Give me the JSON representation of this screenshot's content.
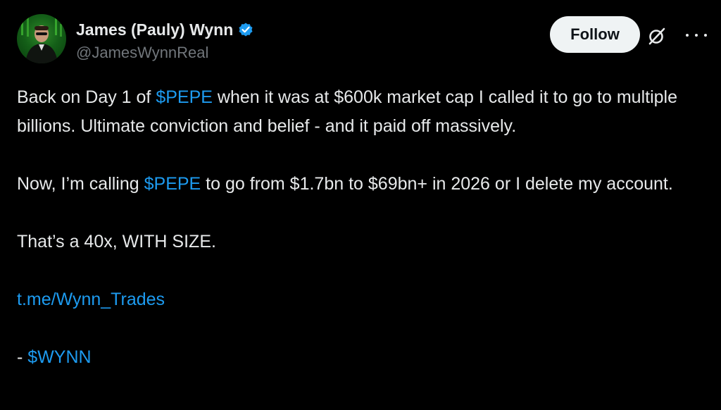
{
  "author": {
    "display_name": "James (Pauly) Wynn",
    "handle": "@JamesWynnReal",
    "avatar_icon": "profile-photo",
    "verified_icon": "verified-badge-icon"
  },
  "actions": {
    "follow_label": "Follow",
    "grok_icon": "grok-icon",
    "more_icon": "more-options-icon"
  },
  "colors": {
    "background": "#000000",
    "text": "#e7e9ea",
    "secondary_text": "#71767b",
    "link": "#1d9bf0",
    "verified": "#1d9bf0",
    "follow_bg": "#eff3f4"
  },
  "post": {
    "p1": {
      "text_a": "Back on Day 1 of ",
      "cashtag": "$PEPE",
      "text_b": " when it was at $600k market cap I called it to go to multiple billions. Ultimate conviction and belief - and it paid off massively."
    },
    "p2": {
      "text_a": "Now, I’m calling ",
      "cashtag": "$PEPE",
      "text_b": " to go from $1.7bn to $69bn+ in 2026 or I delete my account."
    },
    "p3": "That’s a 40x, WITH SIZE.",
    "link": "t.me/Wynn_Trades",
    "sign_prefix": "- ",
    "sign_cashtag": "$WYNN"
  }
}
